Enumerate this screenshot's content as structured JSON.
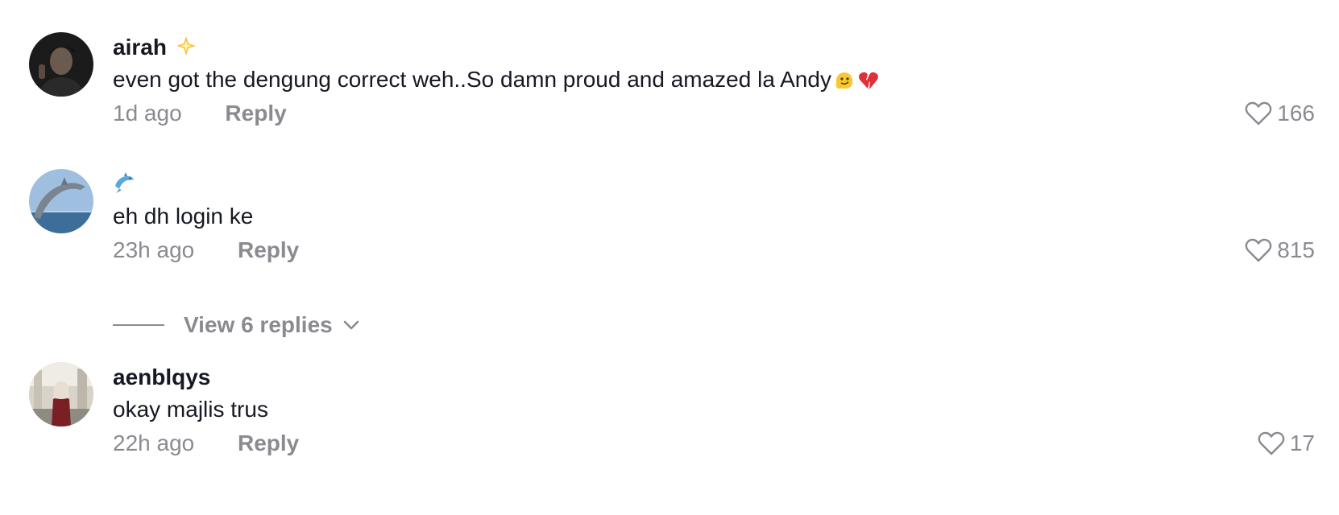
{
  "comments": [
    {
      "username": "airah",
      "username_emoji": "glowing-star-emoji",
      "text": "even got the dengung correct weh..So damn proud and amazed la Andy",
      "text_emojis": [
        "melting-face-emoji",
        "broken-heart-emoji"
      ],
      "time": "1d ago",
      "reply_label": "Reply",
      "likes": "166"
    },
    {
      "username": "",
      "username_emoji": "dolphin-emoji",
      "text": "eh dh login ke",
      "time": "23h ago",
      "reply_label": "Reply",
      "likes": "815",
      "view_replies_label": "View 6 replies"
    },
    {
      "username": "aenblqys",
      "text": "okay majlis trus",
      "time": "22h ago",
      "reply_label": "Reply",
      "likes": "17"
    }
  ],
  "colors": {
    "primary_text": "#161823",
    "secondary_text": "#8a8b91"
  }
}
